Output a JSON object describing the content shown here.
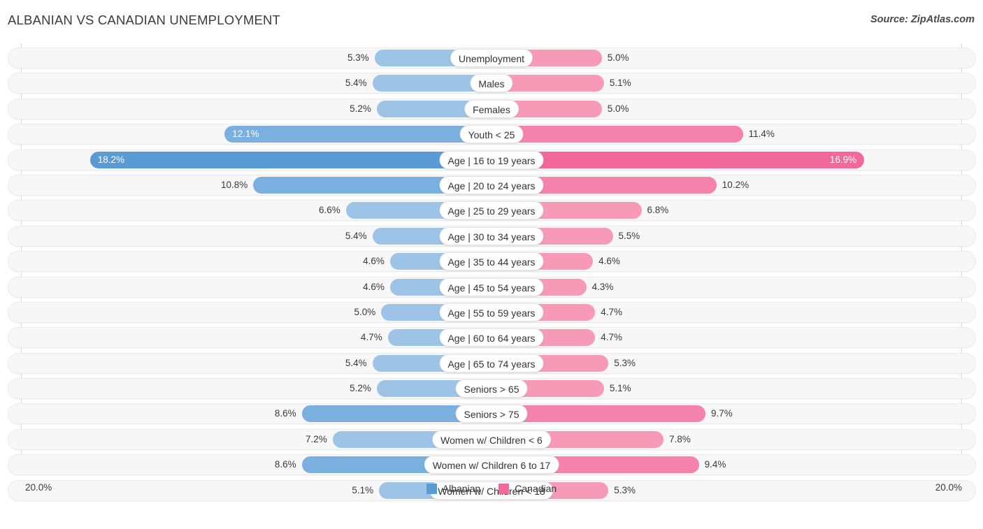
{
  "header": {
    "title": "ALBANIAN VS CANADIAN UNEMPLOYMENT",
    "source": "Source: ZipAtlas.com"
  },
  "axis": {
    "left_label": "20.0%",
    "right_label": "20.0%",
    "max": 20.0
  },
  "legend": {
    "items": [
      {
        "label": "Albanian",
        "color": "#5b9bd5"
      },
      {
        "label": "Canadian",
        "color": "#f2689b"
      }
    ]
  },
  "colors": {
    "albanian_light": "#9dc3e6",
    "albanian_mid": "#7aafdf",
    "albanian_dark": "#5b9bd5",
    "canadian_light": "#f79ab8",
    "canadian_mid": "#f582ab",
    "canadian_dark": "#f2689b",
    "track_bg": "#f7f7f7",
    "track_border": "#ebebeb",
    "gridline": "#d9d9d9"
  },
  "chart_data": {
    "type": "bar",
    "title": "ALBANIAN VS CANADIAN UNEMPLOYMENT",
    "subtitle": "",
    "orientation": "horizontal-diverging",
    "xlabel": "",
    "ylabel": "",
    "xlim": [
      20.0,
      20.0
    ],
    "grid": true,
    "legend_position": "bottom-center",
    "categories": [
      "Unemployment",
      "Males",
      "Females",
      "Youth < 25",
      "Age | 16 to 19 years",
      "Age | 20 to 24 years",
      "Age | 25 to 29 years",
      "Age | 30 to 34 years",
      "Age | 35 to 44 years",
      "Age | 45 to 54 years",
      "Age | 55 to 59 years",
      "Age | 60 to 64 years",
      "Age | 65 to 74 years",
      "Seniors > 65",
      "Seniors > 75",
      "Women w/ Children < 6",
      "Women w/ Children 6 to 17",
      "Women w/ Children < 18"
    ],
    "series": [
      {
        "name": "Albanian",
        "color": "#5b9bd5",
        "values": [
          5.3,
          5.4,
          5.2,
          12.1,
          18.2,
          10.8,
          6.6,
          5.4,
          4.6,
          4.6,
          5.0,
          4.7,
          5.4,
          5.2,
          8.6,
          7.2,
          8.6,
          5.1
        ],
        "labels": [
          "5.3%",
          "5.4%",
          "5.2%",
          "12.1%",
          "18.2%",
          "10.8%",
          "6.6%",
          "5.4%",
          "4.6%",
          "4.6%",
          "5.0%",
          "4.7%",
          "5.4%",
          "5.2%",
          "8.6%",
          "7.2%",
          "8.6%",
          "5.1%"
        ]
      },
      {
        "name": "Canadian",
        "color": "#f2689b",
        "values": [
          5.0,
          5.1,
          5.0,
          11.4,
          16.9,
          10.2,
          6.8,
          5.5,
          4.6,
          4.3,
          4.7,
          4.7,
          5.3,
          5.1,
          9.7,
          7.8,
          9.4,
          5.3
        ],
        "labels": [
          "5.0%",
          "5.1%",
          "5.0%",
          "11.4%",
          "16.9%",
          "10.2%",
          "6.8%",
          "5.5%",
          "4.6%",
          "4.3%",
          "4.7%",
          "4.7%",
          "5.3%",
          "5.1%",
          "9.7%",
          "7.8%",
          "9.4%",
          "5.3%"
        ]
      }
    ]
  }
}
